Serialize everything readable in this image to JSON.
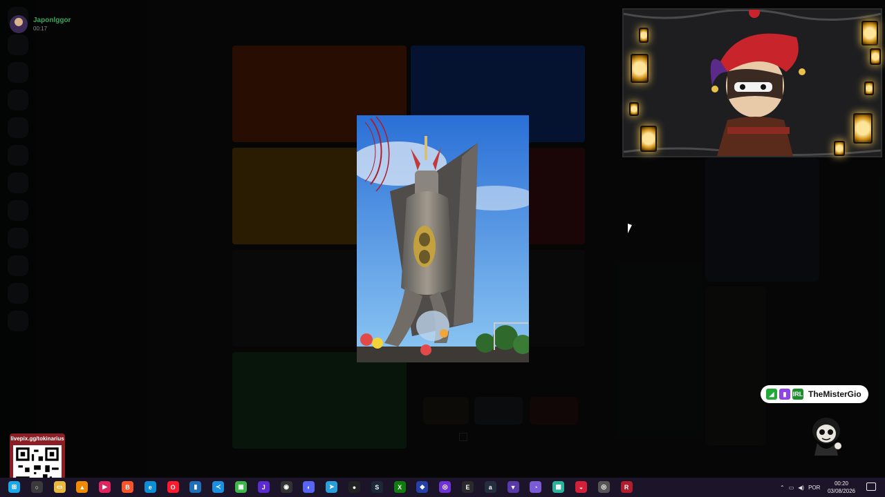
{
  "user": {
    "name": "Japonlggor",
    "time": "00:17"
  },
  "badge": {
    "name": "TheMisterGio",
    "icon_labels": [
      "IRL"
    ]
  },
  "qr": {
    "label": "livepix.gg/tokinarius"
  },
  "taskbar": {
    "apps": [
      {
        "name": "windows-start-icon",
        "color": "#1aa7ec",
        "glyph": "⊞"
      },
      {
        "name": "search-app-icon",
        "color": "#3a3a3a",
        "glyph": "○"
      },
      {
        "name": "file-explorer-icon",
        "color": "#e9b93e",
        "glyph": "▭"
      },
      {
        "name": "vlc-icon",
        "color": "#f08a00",
        "glyph": "▲"
      },
      {
        "name": "media-player-icon",
        "color": "#e0245e",
        "glyph": "▶"
      },
      {
        "name": "brave-browser-icon",
        "color": "#fb542b",
        "glyph": "B"
      },
      {
        "name": "edge-browser-icon",
        "color": "#0d8fd6",
        "glyph": "e"
      },
      {
        "name": "opera-browser-icon",
        "color": "#ff1b2d",
        "glyph": "O"
      },
      {
        "name": "app-blue-icon",
        "color": "#1e6fb8",
        "glyph": "▮"
      },
      {
        "name": "vscode-icon",
        "color": "#1b8fe0",
        "glyph": "≺"
      },
      {
        "name": "app-green-icon",
        "color": "#3db64b",
        "glyph": "▣"
      },
      {
        "name": "jetbrains-icon",
        "color": "#5b2bd1",
        "glyph": "J"
      },
      {
        "name": "github-icon",
        "color": "#333",
        "glyph": "◉"
      },
      {
        "name": "discord-icon",
        "color": "#5865f2",
        "glyph": "◐"
      },
      {
        "name": "telegram-icon",
        "color": "#2aa0da",
        "glyph": "➤"
      },
      {
        "name": "obs-icon",
        "color": "#222",
        "glyph": "●"
      },
      {
        "name": "steam-icon",
        "color": "#1b2838",
        "glyph": "S"
      },
      {
        "name": "xbox-icon",
        "color": "#107c10",
        "glyph": "X"
      },
      {
        "name": "app-dark-blue-icon",
        "color": "#2441a8",
        "glyph": "◆"
      },
      {
        "name": "twitch-icon",
        "color": "#6f32d6",
        "glyph": "◎"
      },
      {
        "name": "epic-games-icon",
        "color": "#2a2a2a",
        "glyph": "E"
      },
      {
        "name": "amazon-icon",
        "color": "#232f3e",
        "glyph": "a"
      },
      {
        "name": "vpn-icon",
        "color": "#5a3aa8",
        "glyph": "▼"
      },
      {
        "name": "app-purple-icon",
        "color": "#7b5ad6",
        "glyph": "◔"
      },
      {
        "name": "app-teal-icon",
        "color": "#28b49b",
        "glyph": "▩"
      },
      {
        "name": "app-red-icon",
        "color": "#d3203a",
        "glyph": "◒"
      },
      {
        "name": "app-gray-icon",
        "color": "#555",
        "glyph": "◎"
      },
      {
        "name": "app-r-icon",
        "color": "#b01e2e",
        "glyph": "R"
      }
    ],
    "language": "POR",
    "clock_time": "00:20",
    "clock_date": "03/08/2026"
  }
}
